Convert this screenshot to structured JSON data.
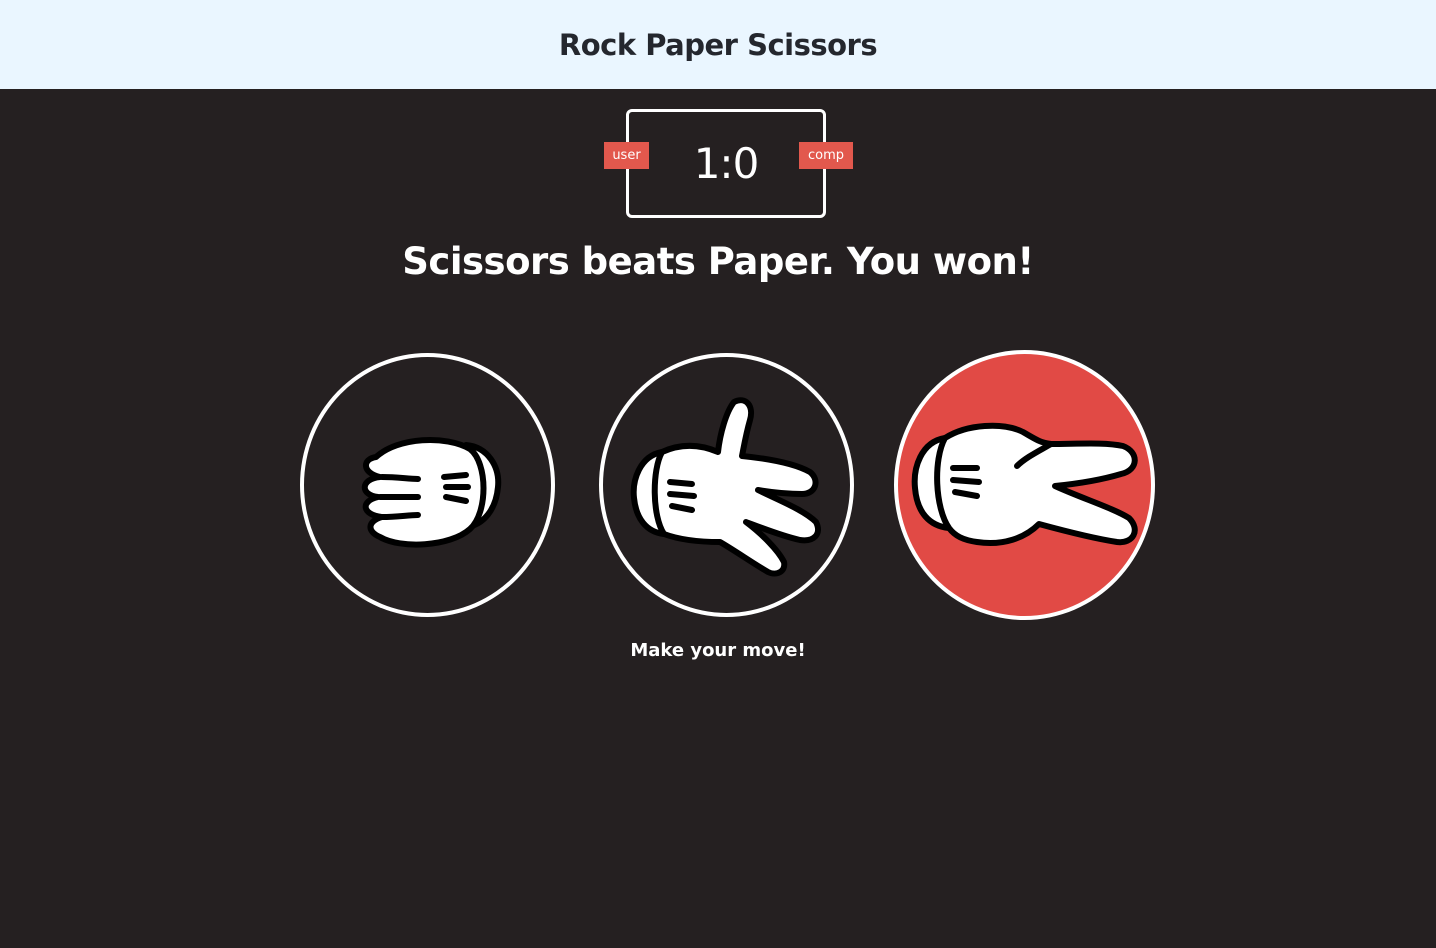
{
  "header": {
    "title": "Rock Paper Scissors"
  },
  "scoreboard": {
    "user_label": "user",
    "comp_label": "comp",
    "score": "1:0"
  },
  "result_message": "Scissors beats Paper. You won!",
  "choices": [
    {
      "id": "rock",
      "icon": "rock-fist-icon",
      "selected": false
    },
    {
      "id": "paper",
      "icon": "paper-hand-icon",
      "selected": false
    },
    {
      "id": "scissors",
      "icon": "scissors-hand-icon",
      "selected": true
    }
  ],
  "prompt": "Make your move!",
  "colors": {
    "header_bg": "#eaf6ff",
    "body_bg": "#252021",
    "accent": "#e2584d",
    "selected_bg": "#e14a45"
  }
}
